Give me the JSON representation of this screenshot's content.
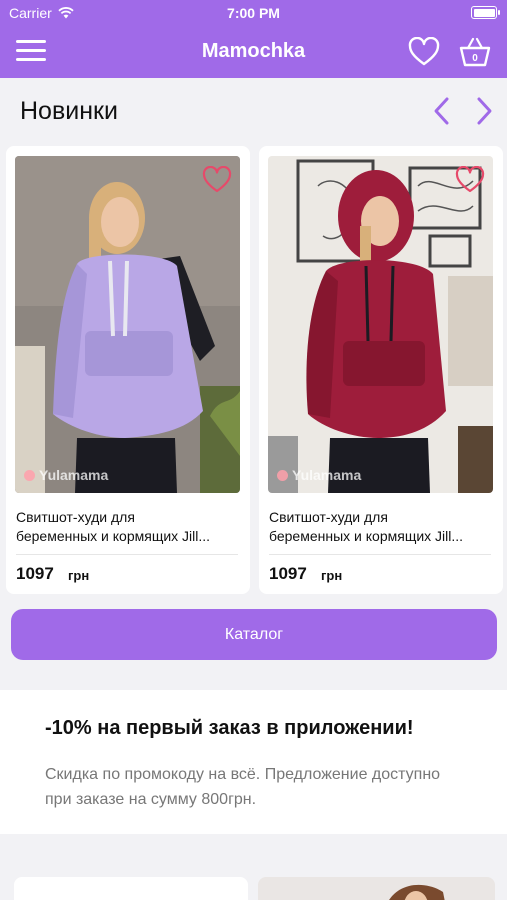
{
  "status_bar": {
    "carrier": "Carrier",
    "time": "7:00 PM"
  },
  "nav": {
    "title": "Mamochka",
    "menu_icon": "hamburger-icon",
    "favorites_icon": "heart-outline-icon",
    "cart_icon": "basket-icon",
    "cart_count": "0"
  },
  "section": {
    "title": "Новинки",
    "prev_icon": "chevron-left-icon",
    "next_icon": "chevron-right-icon"
  },
  "products": [
    {
      "name_line1": "Свитшот-худи для",
      "name_line2": "беременных и кормящих Jill...",
      "price": "1097",
      "currency": "грн",
      "watermark": "Yulamama",
      "hoodie_color": "#b9a7e6"
    },
    {
      "name_line1": "Свитшот-худи для",
      "name_line2": "беременных и кормящих Jill...",
      "price": "1097",
      "currency": "грн",
      "watermark": "Yulamama",
      "hoodie_color": "#9e1d3b"
    }
  ],
  "catalog_button": "Каталог",
  "promo": {
    "headline": "-10% на первый заказ в приложении!",
    "body": "Скидка по промокоду на всё. Предложение доступно при заказе на сумму 800грн."
  },
  "colors": {
    "accent": "#a06ae8",
    "background": "#f2f2f5"
  }
}
